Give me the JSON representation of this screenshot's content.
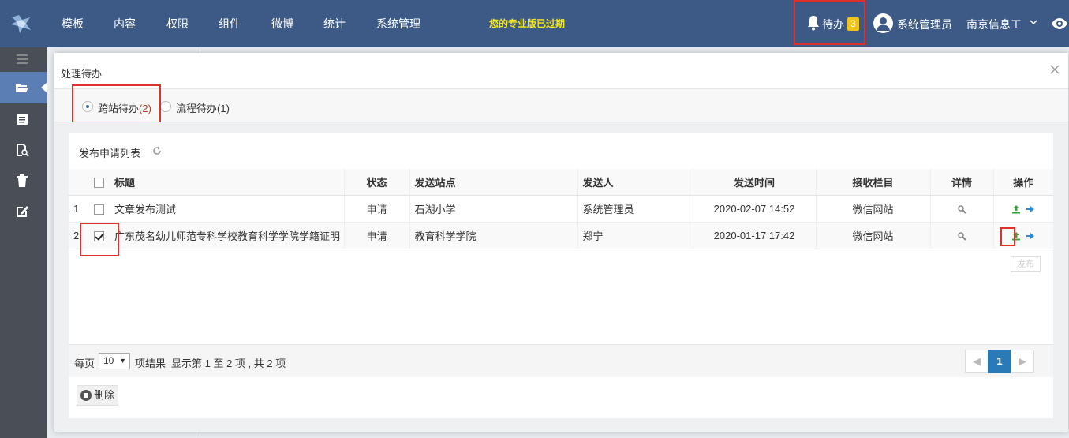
{
  "nav": {
    "items": [
      "模板",
      "内容",
      "权限",
      "组件",
      "微博",
      "统计",
      "系统管理"
    ],
    "expired_notice": "您的专业版已过期",
    "todo_label": "待办",
    "todo_count": "3",
    "user_name": "系统管理员",
    "site_name": "南京信息工"
  },
  "modal": {
    "title": "处理待办",
    "tabs": [
      {
        "label": "跨站待办",
        "count": "(2)"
      },
      {
        "label": "流程待办",
        "count": "(1)"
      }
    ],
    "panel_title": "发布申请列表",
    "columns": {
      "title": "标题",
      "status": "状态",
      "site": "发送站点",
      "sender": "发送人",
      "time": "发送时间",
      "target": "接收栏目",
      "detail": "详情",
      "action": "操作"
    },
    "rows": [
      {
        "index": "1",
        "title": "文章发布测试",
        "status": "申请",
        "site": "石湖小学",
        "sender": "系统管理员",
        "time": "2020-02-07 14:52",
        "target": "微信网站"
      },
      {
        "index": "2",
        "title": "广东茂名幼儿师范专科学校教育科学学院学籍证明（黄",
        "status": "申请",
        "site": "教育科学学院",
        "sender": "郑宁",
        "time": "2020-01-17 17:42",
        "target": "微信网站"
      }
    ],
    "tooltip": "发布",
    "footer": {
      "per_page_label": "每页",
      "per_page_value": "10",
      "results_label": "项结果",
      "summary": "显示第 1 至 2 项 , 共 2 项",
      "current_page": "1"
    },
    "delete_label": "删除"
  },
  "colors": {
    "navbar": "#3c5a85",
    "sidebar": "#4a4f57",
    "highlight": "#e0302a",
    "badge": "#f0c419",
    "accent": "#2a7ab8"
  }
}
